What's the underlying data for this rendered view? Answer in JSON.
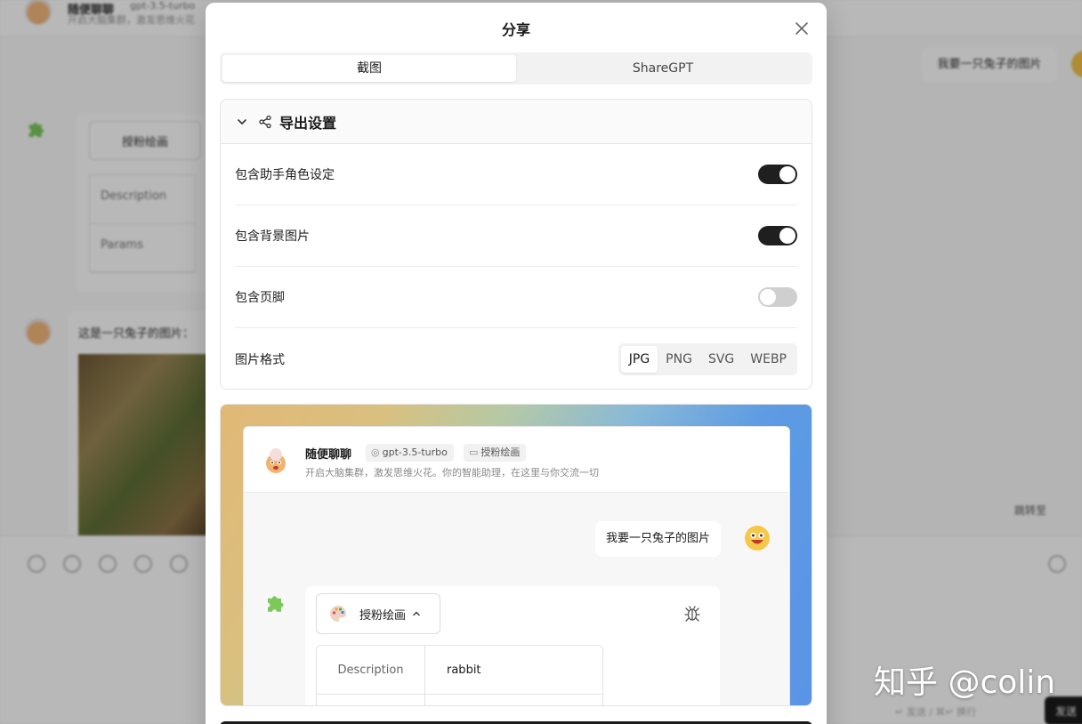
{
  "background": {
    "agent_name": "随便聊聊",
    "model": "gpt-3.5-turbo",
    "agent_desc": "开启大脑集群，激发思维火花",
    "user_message": "我要一只兔子的图片",
    "plugin_name": "授粉绘画",
    "table_keys": [
      "Description",
      "Params"
    ],
    "assistant_message": "这是一只兔子的图片：",
    "jump_label": "跳转至",
    "send_hint": "↵ 发送 / ⌘↵ 换行",
    "send_label": "发送"
  },
  "modal": {
    "title": "分享",
    "tabs": [
      {
        "label": "截图",
        "active": true
      },
      {
        "label": "ShareGPT",
        "active": false
      }
    ],
    "settings": {
      "title": "导出设置",
      "rows": [
        {
          "label": "包含助手角色设定",
          "on": true
        },
        {
          "label": "包含背景图片",
          "on": true
        },
        {
          "label": "包含页脚",
          "on": false
        }
      ],
      "format_label": "图片格式",
      "formats": [
        "JPG",
        "PNG",
        "SVG",
        "WEBP"
      ],
      "selected_format": "JPG"
    },
    "preview": {
      "agent_name": "随便聊聊",
      "model_tag": "gpt-3.5-turbo",
      "plugin_tag": "授粉绘画",
      "agent_desc": "开启大脑集群，激发思维火花。你的智能助理，在这里与你交流一切",
      "user_message": "我要一只兔子的图片",
      "plugin_name": "授粉绘画",
      "table": [
        {
          "key": "Description",
          "value": "rabbit"
        },
        {
          "key": "Params",
          "value": ""
        }
      ]
    }
  },
  "watermark": "知乎 @colin",
  "colors": {
    "accent": "#1f1f1f",
    "switch_off": "#cfcfcf",
    "puzzle_green": "#7cc85b"
  }
}
